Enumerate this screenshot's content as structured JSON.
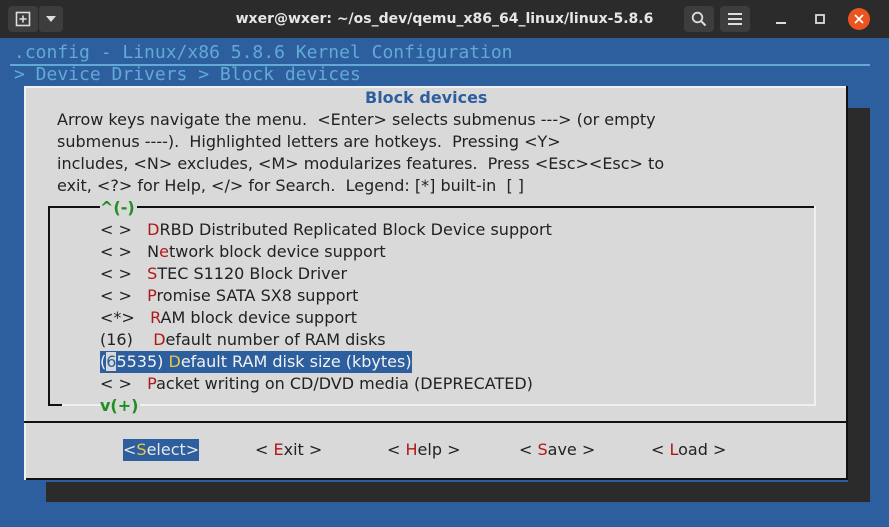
{
  "window": {
    "title": "wxer@wxer: ~/os_dev/qemu_x86_64_linux/linux-5.8.6",
    "new_tab_icon": "new-tab-icon",
    "dropdown_icon": "chevron-down-icon",
    "search_icon": "search-icon",
    "menu_icon": "hamburger-menu-icon",
    "minimize_icon": "minimize-icon",
    "maximize_icon": "maximize-icon",
    "close_icon": "close-icon"
  },
  "header": {
    "config_line": ".config - Linux/x86 5.8.6 Kernel Configuration",
    "breadcrumb_line": "> Device Drivers > Block devices"
  },
  "dialog": {
    "title": "Block devices",
    "help_lines": [
      "Arrow keys navigate the menu.  <Enter> selects submenus ---> (or empty",
      "submenus ----).  Highlighted letters are hotkeys.  Pressing <Y>",
      "includes, <N> excludes, <M> modularizes features.  Press <Esc><Esc> to",
      "exit, <?> for Help, </> for Search.  Legend: [*] built-in  [ ]"
    ],
    "scroll_up": "^(-)",
    "scroll_down": "v(+)",
    "items": [
      {
        "state": "< >",
        "pre": "",
        "hotkey": "D",
        "rest": "RBD Distributed Replicated Block Device support"
      },
      {
        "state": "< >",
        "pre": "N",
        "hotkey": "e",
        "rest": "twork block device support"
      },
      {
        "state": "< >",
        "pre": "",
        "hotkey": "S",
        "rest": "TEC S1120 Block Driver"
      },
      {
        "state": "< >",
        "pre": "",
        "hotkey": "P",
        "rest": "romise SATA SX8 support"
      },
      {
        "state": "<*>",
        "pre": "",
        "hotkey": "R",
        "rest": "AM block device support"
      },
      {
        "state": "(16)",
        "pre": "  ",
        "hotkey": "D",
        "rest": "efault number of RAM disks"
      },
      {
        "state": "(65535)",
        "pre": " ",
        "hotkey": "D",
        "rest": "efault RAM disk size (kbytes)"
      },
      {
        "state": "< >",
        "pre": "",
        "hotkey": "P",
        "rest": "acket writing on CD/DVD media (DEPRECATED)"
      }
    ],
    "selected_item_state_prefix": "(",
    "selected_item_state_cursor": "6",
    "selected_item_state_rest": "5535)",
    "buttons": [
      {
        "open": "<",
        "hotkey": "S",
        "rest": "elect",
        "close": ">"
      },
      {
        "open": "< ",
        "hotkey": "E",
        "rest": "xit",
        "close": " >"
      },
      {
        "open": "< ",
        "hotkey": "H",
        "rest": "elp",
        "close": " >"
      },
      {
        "open": "< ",
        "hotkey": "S",
        "rest": "ave",
        "close": " >"
      },
      {
        "open": "< ",
        "hotkey": "L",
        "rest": "oad",
        "close": " >"
      }
    ]
  }
}
